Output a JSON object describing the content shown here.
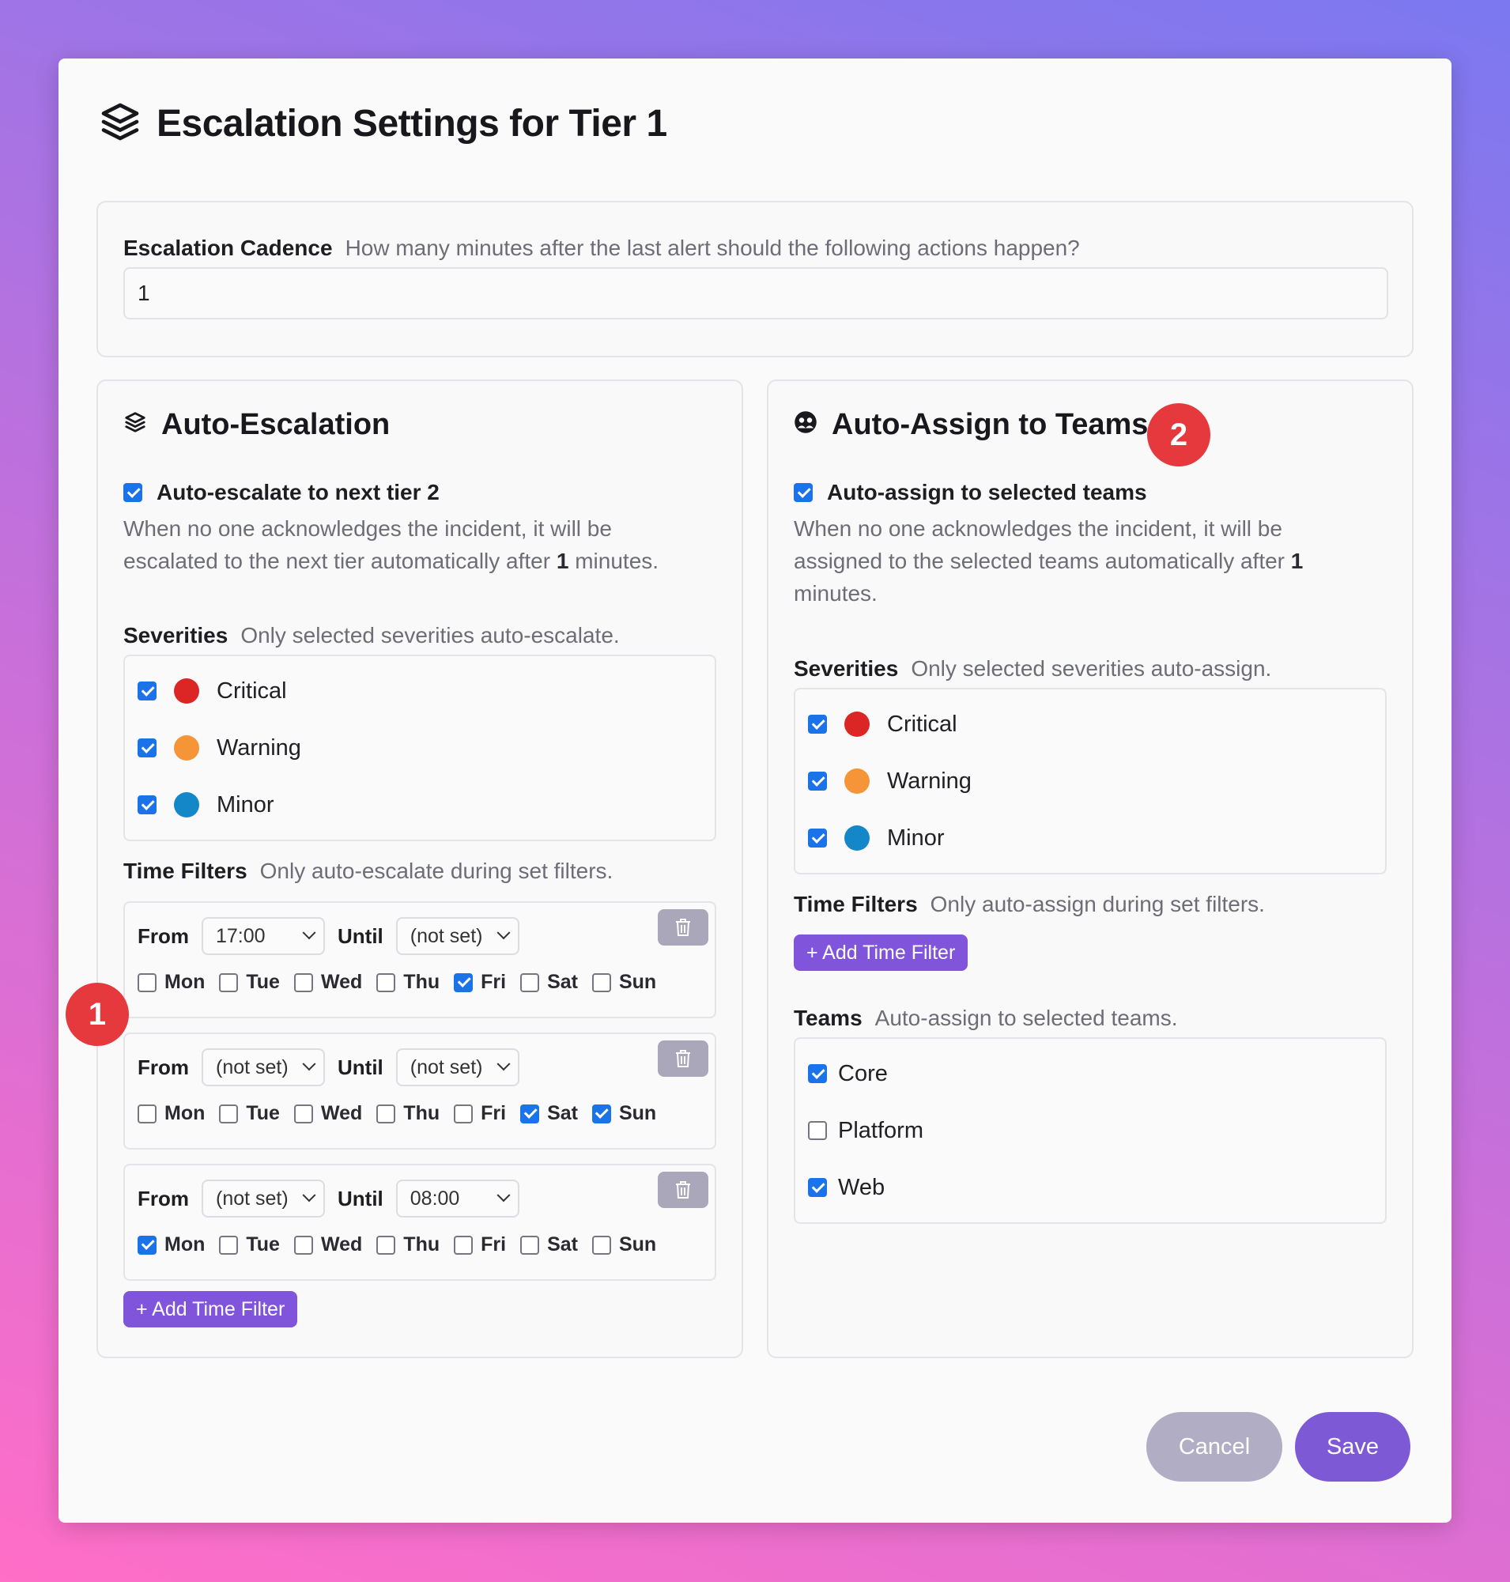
{
  "dialog": {
    "title": "Escalation Settings for Tier 1",
    "icon": "layers-icon"
  },
  "cadence": {
    "label": "Escalation Cadence",
    "hint": "How many minutes after the last alert should the following actions happen?",
    "value": "1"
  },
  "auto_escalation": {
    "title": "Auto-Escalation",
    "icon": "layers-icon",
    "toggle_label": "Auto-escalate to next tier 2",
    "toggle_checked": true,
    "desc_1": "When no one acknowledges the incident, it will be",
    "desc_2_pre": "escalated to the next tier automatically after",
    "desc_minutes": "1",
    "desc_2_post": "minutes.",
    "severities_label": "Severities",
    "severities_hint": "Only selected severities auto-escalate.",
    "severities": [
      {
        "name": "Critical",
        "color": "#dc2626",
        "checked": true
      },
      {
        "name": "Warning",
        "color": "#f59537",
        "checked": true
      },
      {
        "name": "Minor",
        "color": "#1487c9",
        "checked": true
      }
    ],
    "time_filters_label": "Time Filters",
    "time_filters_hint": "Only auto-escalate during set filters.",
    "from_label": "From",
    "until_label": "Until",
    "filters": [
      {
        "from": "17:00",
        "until": "(not set)",
        "days": {
          "Mon": false,
          "Tue": false,
          "Wed": false,
          "Thu": false,
          "Fri": true,
          "Sat": false,
          "Sun": false
        }
      },
      {
        "from": "(not set)",
        "until": "(not set)",
        "days": {
          "Mon": false,
          "Tue": false,
          "Wed": false,
          "Thu": false,
          "Fri": false,
          "Sat": true,
          "Sun": true
        }
      },
      {
        "from": "(not set)",
        "until": "08:00",
        "days": {
          "Mon": true,
          "Tue": false,
          "Wed": false,
          "Thu": false,
          "Fri": false,
          "Sat": false,
          "Sun": false
        }
      }
    ],
    "day_labels": [
      "Mon",
      "Tue",
      "Wed",
      "Thu",
      "Fri",
      "Sat",
      "Sun"
    ],
    "add_filter_label": "+ Add Time Filter"
  },
  "auto_assign": {
    "title": "Auto-Assign to Teams",
    "icon": "team-icon",
    "toggle_label": "Auto-assign to selected teams",
    "toggle_checked": true,
    "desc_1": "When no one acknowledges the incident, it will be",
    "desc_2_pre": "assigned to the selected teams automatically after",
    "desc_minutes": "1",
    "desc_3": "minutes.",
    "severities_label": "Severities",
    "severities_hint": "Only selected severities auto-assign.",
    "severities": [
      {
        "name": "Critical",
        "color": "#dc2626",
        "checked": true
      },
      {
        "name": "Warning",
        "color": "#f59537",
        "checked": true
      },
      {
        "name": "Minor",
        "color": "#1487c9",
        "checked": true
      }
    ],
    "time_filters_label": "Time Filters",
    "time_filters_hint": "Only auto-assign during set filters.",
    "add_filter_label": "+ Add Time Filter",
    "teams_label": "Teams",
    "teams_hint": "Auto-assign to selected teams.",
    "teams": [
      {
        "name": "Core",
        "checked": true
      },
      {
        "name": "Platform",
        "checked": false
      },
      {
        "name": "Web",
        "checked": true
      }
    ]
  },
  "badges": [
    "1",
    "2"
  ],
  "footer": {
    "cancel_label": "Cancel",
    "save_label": "Save",
    "cancel_color": "#b1adc4",
    "save_color": "#7d59d6"
  }
}
